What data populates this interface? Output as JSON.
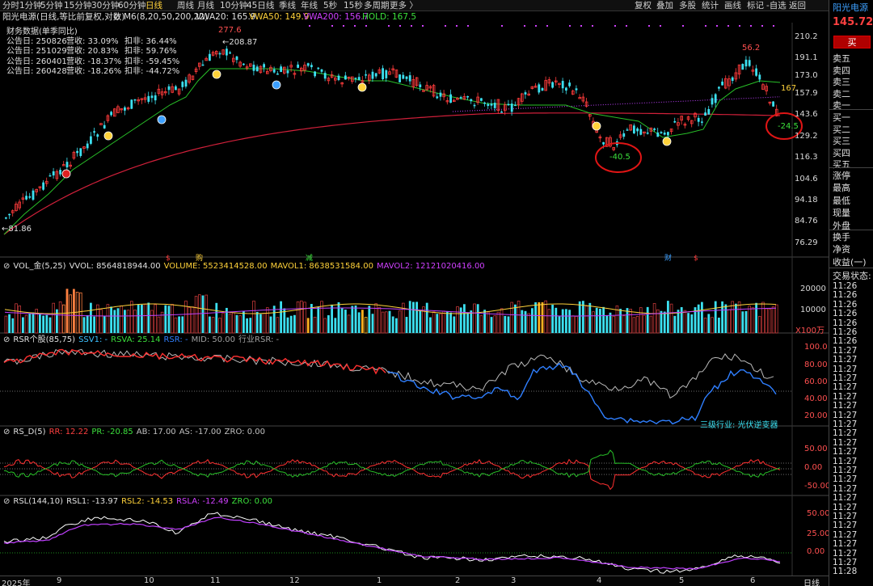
{
  "toolbar": {
    "periods": [
      "分时",
      "1分钟",
      "5分钟",
      "15分钟",
      "30分钟",
      "60分钟",
      "日线",
      "周线",
      "月线",
      "10分钟",
      "45日线",
      "季线",
      "年线",
      "5秒",
      "15秒",
      "多周期",
      "更多 〉"
    ],
    "active_period": "日线",
    "right_items": [
      "复权",
      "叠加",
      "多股",
      "统计",
      "画线",
      "标记",
      "-自选",
      "返回"
    ]
  },
  "title": {
    "stock": "阳光电源(日线,等比前复权,对数)",
    "ma_label": "M6(8,20,50,200,22)",
    "vwa20": "VWA20: 165.9",
    "vwa50": "VWA50: 149.9",
    "vwa200": "VWA200: 156.7",
    "hold": "HOLD: 167.5"
  },
  "financial": {
    "header": "财务数据(单季同比)",
    "rows": [
      {
        "date": "公告日: 250826",
        "rev": "营收: 33.09%",
        "net": "扣非: 36.44%"
      },
      {
        "date": "公告日: 251029",
        "rev": "营收: 20.83%",
        "net": "扣非: 59.76%"
      },
      {
        "date": "公告日: 260401",
        "rev": "营收: -18.37%",
        "net": "扣非: -59.45%"
      },
      {
        "date": "公告日: 260428",
        "rev": "营收: -18.26%",
        "net": "扣非: -44.72%"
      }
    ]
  },
  "price_annotations": {
    "high": "277.6",
    "high2": "208.87",
    "low_left": "81.86",
    "peak_right": "56.2",
    "circle1": "-40.5",
    "circle2": "-24.5",
    "right_edge": "167."
  },
  "price_axis": [
    "210.2",
    "191.1",
    "173.0",
    "157.9",
    "143.6",
    "129.2",
    "116.3",
    "104.6",
    "94.18",
    "84.76",
    "76.29"
  ],
  "event_markers": [
    "$",
    "购",
    "减",
    "财",
    "$"
  ],
  "vol_panel": {
    "name": "VOL_金(5,25)",
    "vvol": "VVOL: 8564818944.00",
    "volume": "VOLUME: 5523414528.00",
    "mavol1": "MAVOL1: 8638531584.00",
    "mavol2": "MAVOL2: 12121020416.00",
    "axis": [
      "20000",
      "10000"
    ],
    "unit": "X100万"
  },
  "rsr_panel": {
    "name": "RSR个股(85,75)",
    "ssv1": "SSV1: -",
    "rsva": "RSVA: 25.14",
    "rsr": "RSR: -",
    "mid": "MID: 50.00",
    "industry": "行业RSR: -",
    "note": "三级行业: 光伏逆变器",
    "axis": [
      "100.0",
      "80.00",
      "60.00",
      "40.00",
      "20.00"
    ]
  },
  "rsd_panel": {
    "name": "RS_D(5)",
    "rr": "RR: 12.22",
    "pr": "PR: -20.85",
    "ab": "AB: 17.00",
    "as": "AS: -17.00",
    "zro": "ZRO: 0.00",
    "axis": [
      "50.00",
      "0.00",
      "-50.00"
    ]
  },
  "rsl_panel": {
    "name": "RSL(144,10)",
    "rsl1": "RSL1: -13.97",
    "rsl2": "RSL2: -14.53",
    "rsla": "RSLA: -12.49",
    "zro": "ZRO: 0.00",
    "axis": [
      "50.00",
      "25.00",
      "0.00"
    ]
  },
  "date_axis": [
    "2025年",
    "9",
    "10",
    "11",
    "12",
    "1",
    "2",
    "3",
    "4",
    "5",
    "6"
  ],
  "bottom_right": "日线",
  "side": {
    "name": "阳光电源",
    "price": "145.72",
    "buy": "买",
    "sell_levels": [
      "卖五",
      "卖四",
      "卖三",
      "卖二",
      "卖一"
    ],
    "buy_levels": [
      "买一",
      "买二",
      "买三",
      "买四",
      "买五"
    ],
    "stats": [
      "涨停",
      "最高",
      "最低",
      "现量",
      "外盘"
    ],
    "stats2": [
      "换手",
      "净资",
      "收益(一)"
    ],
    "trade_status": "交易状态: ",
    "times": [
      "11:26",
      "11:26",
      "11:26",
      "11:26",
      "11:26",
      "11:26",
      "11:26",
      "11:27",
      "11:27",
      "11:27",
      "11:27",
      "11:27",
      "11:27",
      "11:27",
      "11:27",
      "11:27",
      "11:27",
      "11:27",
      "11:27",
      "11:27",
      "11:27",
      "11:27",
      "11:27",
      "11:27",
      "11:27",
      "11:27",
      "11:27",
      "11:27",
      "11:27",
      "11:27",
      "11:27",
      "11:28"
    ]
  },
  "colors": {
    "up": "#ff3b3b",
    "down": "#3ce0f0",
    "ma_green": "#28c028",
    "ma_red": "#d0203a",
    "purple": "#c040ff",
    "yellow": "#ffd23a",
    "blue": "#2f7fff"
  }
}
